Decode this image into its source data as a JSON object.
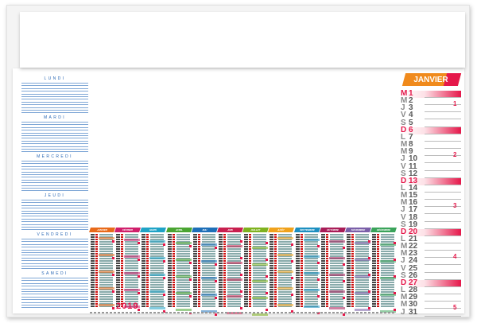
{
  "colors": {
    "accent": "#e5174a",
    "orange": "#f08a1c",
    "blue": "#2766b4"
  },
  "notes": {
    "days": [
      "LUNDI",
      "MARDI",
      "MERCREDI",
      "JEUDI",
      "VENDREDI",
      "SAMEDI"
    ]
  },
  "year": "2019",
  "months": [
    {
      "name": "JANVIER",
      "color": "#e86a1a"
    },
    {
      "name": "FÉVRIER",
      "color": "#d01f6b"
    },
    {
      "name": "MARS",
      "color": "#1fa3c6"
    },
    {
      "name": "AVRIL",
      "color": "#4aa532"
    },
    {
      "name": "MAI",
      "color": "#1d6fb8"
    },
    {
      "name": "JUIN",
      "color": "#c8204f"
    },
    {
      "name": "JUILLET",
      "color": "#7fb21f"
    },
    {
      "name": "AOÛT",
      "color": "#f0a21c"
    },
    {
      "name": "SEPTEMBRE",
      "color": "#1d8fc0"
    },
    {
      "name": "OCTOBRE",
      "color": "#a81c57"
    },
    {
      "name": "NOVEMBRE",
      "color": "#7a5fa8"
    },
    {
      "name": "DÉCEMBRE",
      "color": "#3aa35a"
    }
  ],
  "january": {
    "title": "JANVIER",
    "days": [
      {
        "l": "M",
        "d": "1"
      },
      {
        "l": "M",
        "d": "2"
      },
      {
        "l": "J",
        "d": "3"
      },
      {
        "l": "V",
        "d": "4"
      },
      {
        "l": "S",
        "d": "5"
      },
      {
        "l": "D",
        "d": "6"
      },
      {
        "l": "L",
        "d": "7"
      },
      {
        "l": "M",
        "d": "8"
      },
      {
        "l": "M",
        "d": "9"
      },
      {
        "l": "J",
        "d": "10"
      },
      {
        "l": "V",
        "d": "11"
      },
      {
        "l": "S",
        "d": "12"
      },
      {
        "l": "D",
        "d": "13"
      },
      {
        "l": "L",
        "d": "14"
      },
      {
        "l": "M",
        "d": "15"
      },
      {
        "l": "M",
        "d": "16"
      },
      {
        "l": "J",
        "d": "17"
      },
      {
        "l": "V",
        "d": "18"
      },
      {
        "l": "S",
        "d": "19"
      },
      {
        "l": "D",
        "d": "20"
      },
      {
        "l": "L",
        "d": "21"
      },
      {
        "l": "M",
        "d": "22"
      },
      {
        "l": "M",
        "d": "23"
      },
      {
        "l": "J",
        "d": "24"
      },
      {
        "l": "V",
        "d": "25"
      },
      {
        "l": "S",
        "d": "26"
      },
      {
        "l": "D",
        "d": "27"
      },
      {
        "l": "L",
        "d": "28"
      },
      {
        "l": "M",
        "d": "29"
      },
      {
        "l": "M",
        "d": "30"
      },
      {
        "l": "J",
        "d": "31"
      }
    ],
    "highlight": [
      0,
      5,
      12,
      19,
      26
    ],
    "weeks": [
      "1",
      "2",
      "3",
      "4",
      "5"
    ]
  }
}
